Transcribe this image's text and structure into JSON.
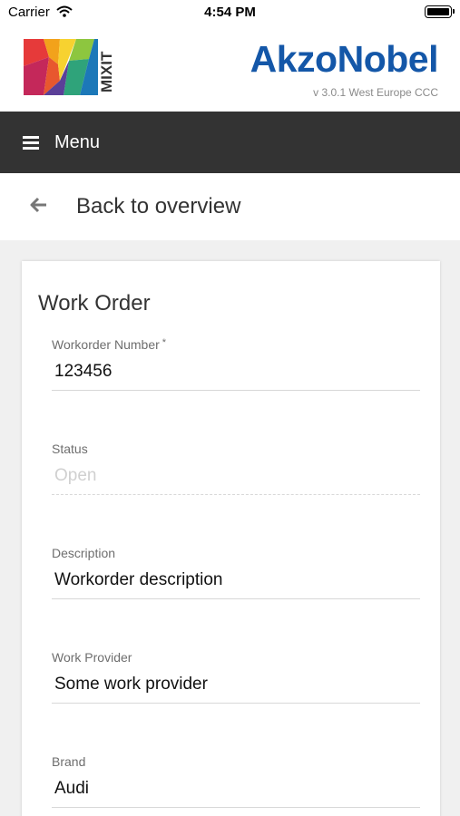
{
  "status_bar": {
    "carrier": "Carrier",
    "time": "4:54 PM"
  },
  "header": {
    "brand": "AkzoNobel",
    "version": "v 3.0.1 West Europe CCC",
    "logo_text": "MIXIT"
  },
  "menu": {
    "label": "Menu"
  },
  "nav": {
    "back_label": "Back to overview"
  },
  "form": {
    "title": "Work Order",
    "fields": [
      {
        "label": "Workorder Number",
        "required_mark": "*",
        "value": "123456"
      },
      {
        "label": "Status",
        "value": "Open"
      },
      {
        "label": "Description",
        "value": "Workorder description"
      },
      {
        "label": "Work Provider",
        "value": "Some work provider"
      },
      {
        "label": "Brand",
        "value": "Audi"
      }
    ]
  },
  "colors": {
    "brand_blue": "#1457a8",
    "menu_bar": "#333333",
    "background": "#f0f0f0"
  },
  "icons": [
    "wifi-icon",
    "battery-icon",
    "hamburger-icon",
    "back-arrow-icon"
  ]
}
